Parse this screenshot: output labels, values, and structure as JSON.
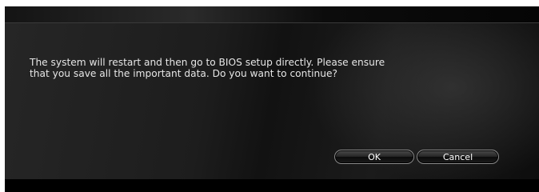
{
  "dialog": {
    "message": "The system will restart and then go to BIOS setup directly. Please ensure\nthat you save all the important data. Do you want to continue?",
    "ok_label": "OK",
    "cancel_label": "Cancel"
  }
}
